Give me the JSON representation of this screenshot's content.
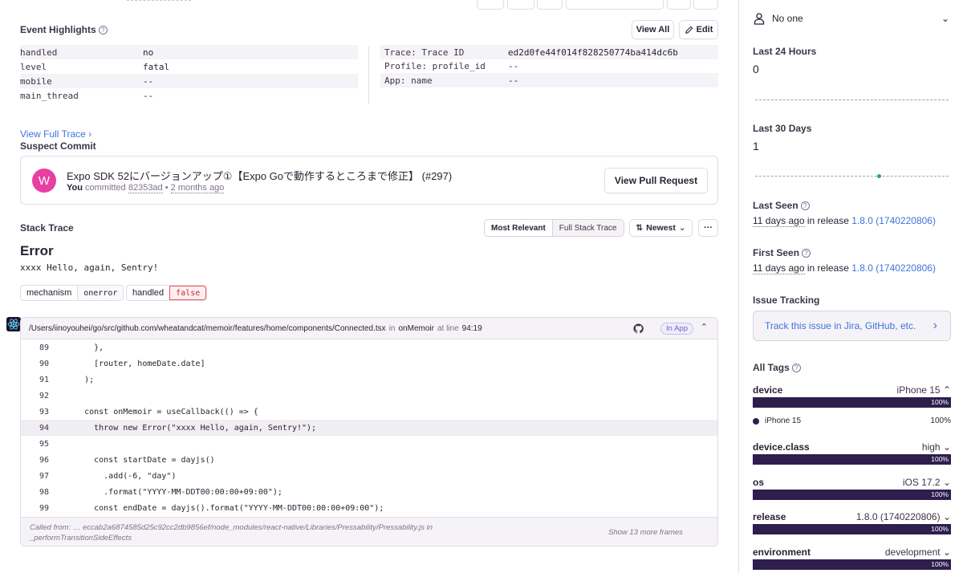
{
  "highlights": {
    "title": "Event Highlights",
    "view_all": "View All",
    "edit": "Edit",
    "left": [
      {
        "key": "handled",
        "value": "no"
      },
      {
        "key": "level",
        "value": "fatal"
      },
      {
        "key": "mobile",
        "value": "--"
      },
      {
        "key": "main_thread",
        "value": "--"
      }
    ],
    "right": [
      {
        "key": "Trace: Trace ID",
        "value": "ed2d0fe44f014f828250774ba414dc6b"
      },
      {
        "key": "Profile: profile_id",
        "value": "--"
      },
      {
        "key": "App: name",
        "value": "--"
      }
    ]
  },
  "view_full_trace": "View Full Trace",
  "suspect_commit": {
    "title": "Suspect Commit",
    "avatar_letter": "W",
    "message": "Expo SDK 52にバージョンアップ①【Expo Goで動作するところまで修正】 (#297)",
    "author": "You",
    "verb": "committed",
    "sha": "82353ad",
    "sep": "•",
    "time": "2 months ago",
    "button": "View Pull Request"
  },
  "stack_trace": {
    "title": "Stack Trace",
    "most_relevant": "Most Relevant",
    "full_stack": "Full Stack Trace",
    "sort": "Newest",
    "more": "···",
    "error_type": "Error",
    "error_message": "xxxx Hello, again, Sentry!",
    "tags": [
      {
        "key": "mechanism",
        "value": "onerror"
      },
      {
        "key": "handled",
        "value": "false"
      }
    ],
    "frame": {
      "path": "/Users/iinoyouhei/go/src/github.com/wheatandcat/memoir/features/home/components/Connected.tsx",
      "in": "in",
      "function": "onMemoir",
      "at_line": "at line",
      "line_col": "94:19",
      "in_app": "In App",
      "lines": [
        {
          "no": "89",
          "code": "      },"
        },
        {
          "no": "90",
          "code": "      [router, homeDate.date]"
        },
        {
          "no": "91",
          "code": "    );"
        },
        {
          "no": "92",
          "code": ""
        },
        {
          "no": "93",
          "code": "    const onMemoir = useCallback(() => {"
        },
        {
          "no": "94",
          "code": "      throw new Error(\"xxxx Hello, again, Sentry!\");"
        },
        {
          "no": "95",
          "code": ""
        },
        {
          "no": "96",
          "code": "      const startDate = dayjs()"
        },
        {
          "no": "97",
          "code": "        .add(-6, \"day\")"
        },
        {
          "no": "98",
          "code": "        .format(\"YYYY-MM-DDT00:00:00+09:00\");"
        },
        {
          "no": "99",
          "code": "      const endDate = dayjs().format(\"YYYY-MM-DDT00:00:00+09:00\");"
        }
      ],
      "called_from_1": "Called from: … eccab2a6874585d25c92cc2db9856ef/node_modules/react-native/Libraries/Pressability/Pressability.js  in",
      "called_from_2": "_performTransitionSideEffects",
      "show_more": "Show 13 more frames"
    }
  },
  "sidebar": {
    "assignee": "No one",
    "last24_title": "Last 24 Hours",
    "last24_value": "0",
    "last30_title": "Last 30 Days",
    "last30_value": "1",
    "last_seen_title": "Last Seen",
    "last_seen_time": "11 days ago",
    "last_seen_release_prefix": "in release",
    "last_seen_release": "1.8.0 (1740220806)",
    "first_seen_title": "First Seen",
    "first_seen_time": "11 days ago",
    "first_seen_release_prefix": "in release",
    "first_seen_release": "1.8.0 (1740220806)",
    "issue_tracking_title": "Issue Tracking",
    "issue_tracking_button": "Track this issue in Jira, GitHub, etc.",
    "all_tags_title": "All Tags",
    "tags": [
      {
        "name": "device",
        "value": "iPhone 15",
        "pct": "100%"
      },
      {
        "name": "device.class",
        "value": "high",
        "pct": "100%"
      },
      {
        "name": "os",
        "value": "iOS 17.2",
        "pct": "100%"
      },
      {
        "name": "release",
        "value": "1.8.0 (1740220806)",
        "pct": "100%"
      },
      {
        "name": "environment",
        "value": "development",
        "pct": "100%"
      }
    ],
    "device_breakdown": {
      "label": "iPhone 15",
      "pct": "100%"
    }
  },
  "colors": {
    "accent": "#6c5fc7",
    "link": "#3d74db",
    "bar": "#2d1e4d",
    "avatar": "#e83fa0",
    "error_red": "#f55459"
  }
}
